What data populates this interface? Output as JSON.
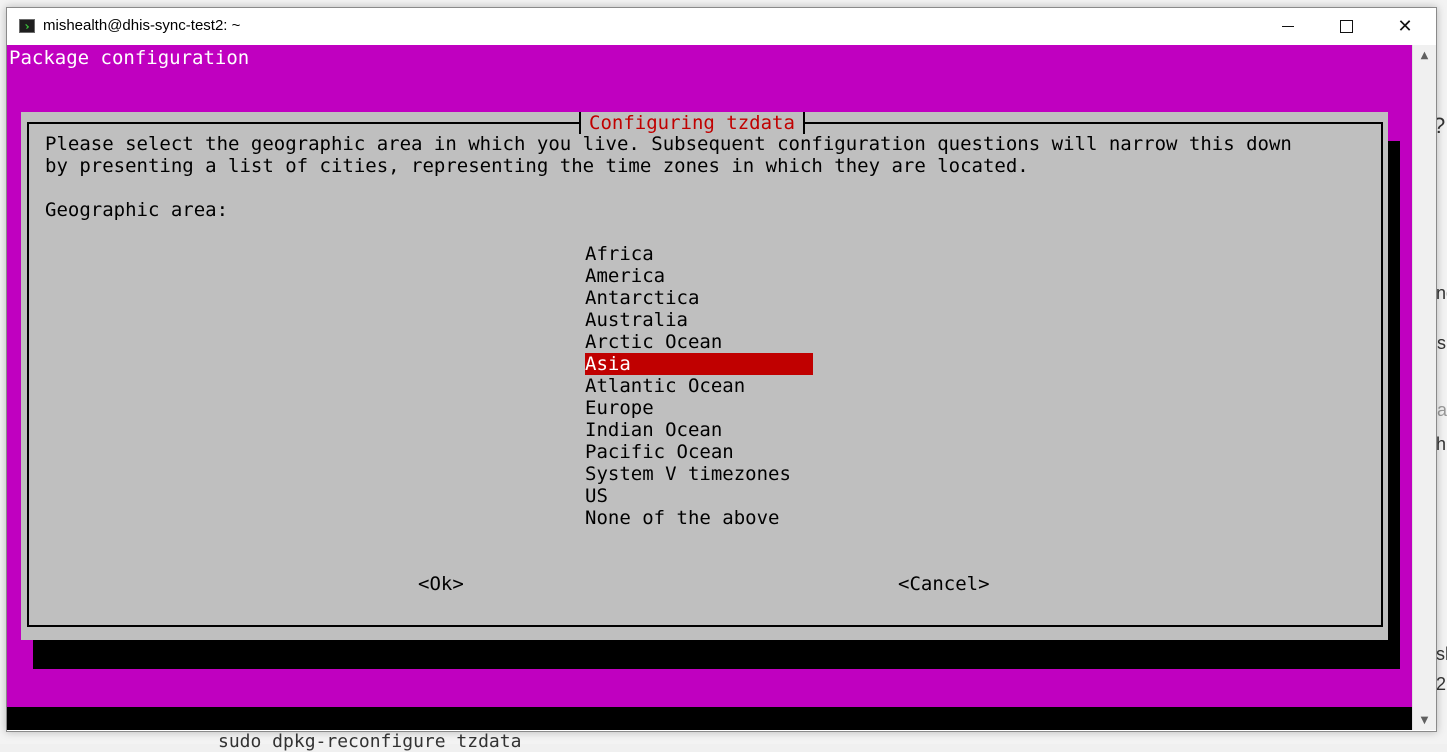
{
  "window": {
    "title": "mishealth@dhis-sync-test2: ~",
    "minimize_label": "",
    "maximize_label": "",
    "close_label": "✕"
  },
  "terminal": {
    "header": "Package configuration"
  },
  "dialog": {
    "title": "Configuring tzdata",
    "description_line1": "Please select the geographic area in which you live. Subsequent configuration questions will narrow this down",
    "description_line2": "by presenting a list of cities, representing the time zones in which they are located.",
    "prompt": "Geographic area:",
    "areas": [
      {
        "label": "Africa",
        "selected": false
      },
      {
        "label": "America",
        "selected": false
      },
      {
        "label": "Antarctica",
        "selected": false
      },
      {
        "label": "Australia",
        "selected": false
      },
      {
        "label": "Arctic Ocean",
        "selected": false
      },
      {
        "label": "Asia",
        "selected": true
      },
      {
        "label": "Atlantic Ocean",
        "selected": false
      },
      {
        "label": "Europe",
        "selected": false
      },
      {
        "label": "Indian Ocean",
        "selected": false
      },
      {
        "label": "Pacific Ocean",
        "selected": false
      },
      {
        "label": "System V timezones",
        "selected": false
      },
      {
        "label": "US",
        "selected": false
      },
      {
        "label": "None of the above",
        "selected": false
      }
    ],
    "ok_label": "<Ok>",
    "cancel_label": "<Cancel>"
  },
  "background": {
    "bottom_text": "sudo dpkg-reconfigure tzdata",
    "right_fragments": [
      "?",
      "ng",
      "s",
      "a",
      "hi",
      "sh",
      "2"
    ]
  },
  "colors": {
    "terminal_bg": "#c000c0",
    "dialog_bg": "#bfbfbf",
    "accent_red": "#c00000"
  }
}
